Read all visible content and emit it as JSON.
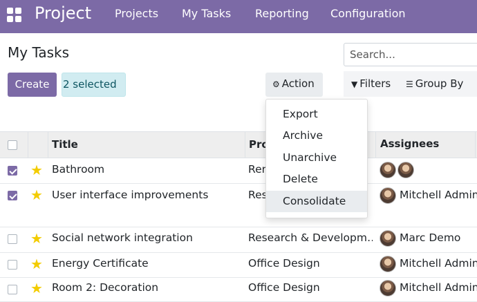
{
  "navbar": {
    "brand": "Project",
    "items": [
      "Projects",
      "My Tasks",
      "Reporting",
      "Configuration"
    ]
  },
  "control_panel": {
    "title": "My Tasks",
    "search_placeholder": "Search...",
    "create_label": "Create",
    "selected_label": "2 selected",
    "action_label": "Action",
    "filters_label": "Filters",
    "groupby_label": "Group By"
  },
  "action_menu": {
    "items": [
      "Export",
      "Archive",
      "Unarchive",
      "Delete",
      "Consolidate"
    ],
    "highlighted": "Consolidate"
  },
  "table": {
    "columns": [
      "Title",
      "Pro",
      "Assignees"
    ],
    "rows": [
      {
        "title": "Bathroom",
        "project": "Ren",
        "assignee": "",
        "checked": true
      },
      {
        "title": "User interface improvements",
        "project": "Res",
        "assignee": "Mitchell Admin",
        "checked": true
      },
      {
        "title": "Social network integration",
        "project": "Research & Developm…",
        "assignee": "Marc Demo",
        "checked": false
      },
      {
        "title": "Energy Certificate",
        "project": "Office Design",
        "assignee": "Mitchell Admin",
        "checked": false
      },
      {
        "title": "Room 2: Decoration",
        "project": "Office Design",
        "assignee": "Mitchell Admin",
        "checked": false
      }
    ]
  },
  "colors": {
    "brand": "#7c6aa6",
    "star": "#f3cc00",
    "selected_badge_bg": "#d1ecf1"
  },
  "icons": [
    "apps-grid-icon",
    "gear-icon",
    "filter-icon",
    "group-by-icon",
    "star-icon",
    "avatar-icon"
  ]
}
